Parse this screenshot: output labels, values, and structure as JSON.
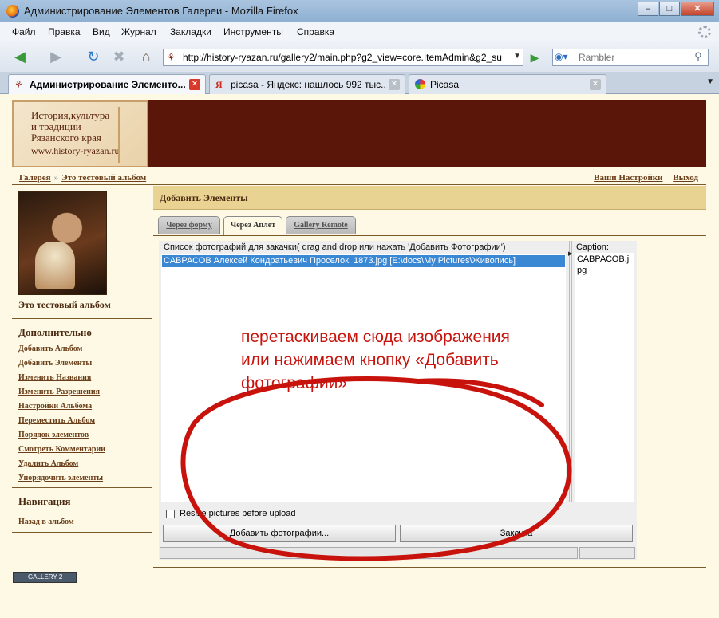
{
  "window": {
    "title": "Администрирование Элементов Галереи - Mozilla Firefox",
    "min": "–",
    "max": "□",
    "close": "✕"
  },
  "menu": [
    "Файл",
    "Правка",
    "Вид",
    "Журнал",
    "Закладки",
    "Инструменты",
    "Справка"
  ],
  "nav": {
    "url": "http://history-ryazan.ru/gallery2/main.php?g2_view=core.ItemAdmin&g2_su",
    "search_placeholder": "Rambler"
  },
  "tabs": [
    {
      "label": "Администрирование Элементо...",
      "icon": "gallery-favicon",
      "active": true
    },
    {
      "label": "picasa - Яндекс: нашлось 992 тыс....",
      "icon": "yandex-favicon",
      "active": false
    },
    {
      "label": "Picasa",
      "icon": "picasa-favicon",
      "active": false
    }
  ],
  "logo_lines": [
    "История,культура",
    "и традиции",
    "Рязанского края",
    "www.history-ryazan.ru"
  ],
  "breadcrumb": [
    "Галерея",
    "Это тестовый альбом"
  ],
  "toplinks": {
    "settings": "Ваши Настройки",
    "logout": "Выход"
  },
  "sidebar": {
    "album_title": "Это тестовый альбом",
    "extra_heading": "Дополнительно",
    "extra_links": [
      "Добавить Альбом",
      "Добавить Элементы",
      "Изменить Названия",
      "Изменить Разрешения",
      "Настройки Альбома",
      "Переместить Альбом",
      "Порядок элементов",
      "Смотреть Комментарии",
      "Удалить Альбом",
      "Упорядочить элементы"
    ],
    "nav_heading": "Навигация",
    "nav_links": [
      "Назад в альбом"
    ]
  },
  "main": {
    "heading": "Добавить Элементы",
    "tabs": [
      "Через форму",
      "Через Аплет",
      "Gallery Remote"
    ],
    "active_tab": 1
  },
  "applet": {
    "list_label": "Список фотографий для закачки( drag and drop  или нажать 'Добавить Фотографии')",
    "files": [
      "САВРАСОВ Алексей Кондратьевич Проселок. 1873.jpg [E:\\docs\\My Pictures\\Живопись]"
    ],
    "caption_label": "Caption:",
    "caption_value": "САВРАСОВ.jpg",
    "resize_label": "Resize pictures before upload",
    "add_button": "Добавить фотографии...",
    "upload_button": "Закачка"
  },
  "annotation": [
    "перетаскиваем сюда изображения",
    "или нажимаем кнопку «Добавить",
    "фотографии»"
  ],
  "footer_badge": "GALLERY 2",
  "colors": {
    "banner": "#5a1608",
    "header_band": "#e8d392",
    "annotation": "#c8130d",
    "selection": "#3a87d4"
  }
}
